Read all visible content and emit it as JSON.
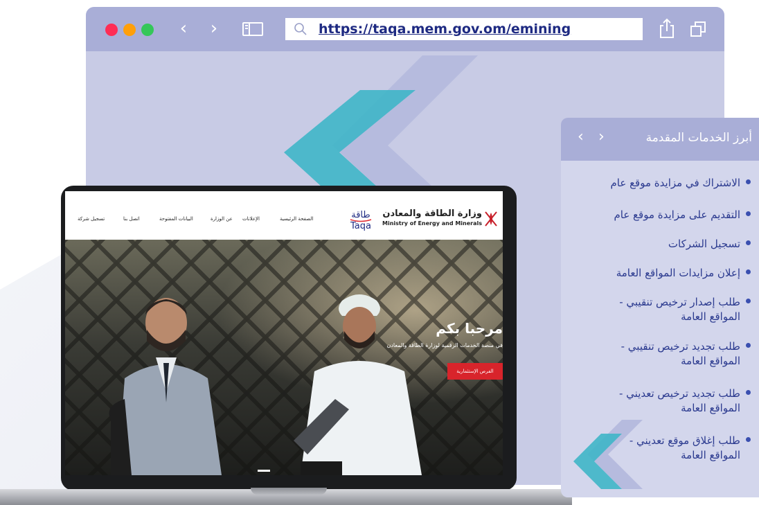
{
  "browser": {
    "url": "https://taqa.mem.gov.om/emining"
  },
  "site": {
    "ministry_ar": "وزارة الطاقة والمعادن",
    "ministry_en": "Ministry of Energy and Minerals",
    "logo_ar": "طاقة",
    "logo_en": "Taqa",
    "nav": [
      "الصفحة الرئيسية",
      "الإعلانات",
      "عن الوزارة",
      "البيانات المفتوحة",
      "اتصل بنا",
      "تسجيل شركة"
    ],
    "hero_title": "مرحبا بكم",
    "hero_subtitle": "في منصة الخدمات الرقمية لوزارة الطاقة والمعادن",
    "hero_button": "الفرص الإستثمارية"
  },
  "panel": {
    "title": "أبرز الخدمات المقدمة",
    "items": [
      {
        "line1": "الاشتراك في مزايدة موقع عام",
        "line2": ""
      },
      {
        "line1": "التقديم على مزايدة موقع عام",
        "line2": ""
      },
      {
        "line1": "تسجيل الشركات",
        "line2": ""
      },
      {
        "line1": "إعلان مزايدات المواقع العامة",
        "line2": ""
      },
      {
        "line1": "طلب إصدار ترخيص تنقيبي -",
        "line2": "المواقع العامة"
      },
      {
        "line1": "طلب تجديد ترخيص تنقيبي -",
        "line2": "المواقع العامة"
      },
      {
        "line1": "طلب تجديد ترخيص تعديني -",
        "line2": "المواقع العامة"
      },
      {
        "line1": "طلب إغلاق موقع تعديني -",
        "line2": "المواقع العامة"
      }
    ]
  },
  "colors": {
    "browser_toolbar": "#a9aed7",
    "browser_body": "#c8cbe5",
    "url_text": "#1e2a82",
    "panel_text": "#2b3a8f",
    "accent_teal": "#3fb6c8",
    "hero_button": "#d8242b"
  }
}
